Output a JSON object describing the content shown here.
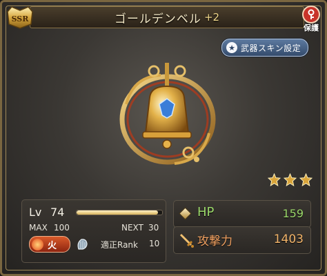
{
  "header": {
    "weapon_name": "ゴールデンベル",
    "plus": "+2",
    "rarity_badge": "SSR",
    "protect_label": "保護"
  },
  "skin_button": {
    "label": "武器スキン設定",
    "icon": "star-icon"
  },
  "weapon": {
    "icon": "golden-bell-weapon-art",
    "uncap_stars": 3
  },
  "level": {
    "lv_label": "Lv",
    "lv_value": "74",
    "progress": 0.95,
    "max_label": "MAX",
    "max_value": "100",
    "next_label": "NEXT",
    "next_value": "30"
  },
  "element": {
    "label": "火",
    "color": "#d95a2a",
    "icon": "fire-element-icon"
  },
  "weapon_type": {
    "icon": "harp-weapon-type-icon"
  },
  "rank": {
    "label": "適正Rank",
    "value": "10"
  },
  "stats": {
    "hp": {
      "label": "HP",
      "value": "159",
      "color": "#9bd86a"
    },
    "attack": {
      "label": "攻撃力",
      "value": "1403",
      "color": "#f0a060"
    }
  }
}
